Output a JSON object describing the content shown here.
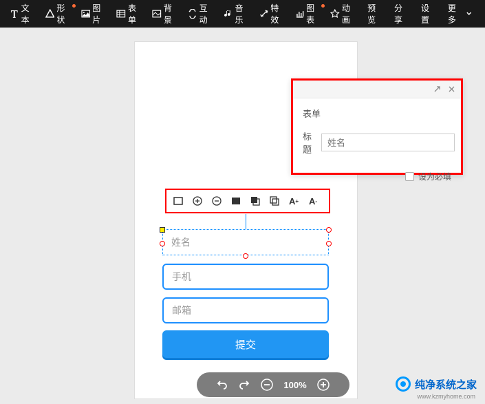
{
  "toolbar": {
    "items": [
      {
        "label": "文本"
      },
      {
        "label": "形状"
      },
      {
        "label": "图片"
      },
      {
        "label": "表单"
      },
      {
        "label": "背景"
      },
      {
        "label": "互动"
      },
      {
        "label": "音乐"
      },
      {
        "label": "特效"
      },
      {
        "label": "图表"
      },
      {
        "label": "动画"
      }
    ],
    "right": [
      {
        "label": "预览"
      },
      {
        "label": "分享"
      },
      {
        "label": "设置"
      },
      {
        "label": "更多"
      }
    ]
  },
  "form": {
    "fields": [
      {
        "placeholder": "姓名"
      },
      {
        "placeholder": "手机"
      },
      {
        "placeholder": "邮箱"
      }
    ],
    "submit": "提交"
  },
  "zoom": {
    "value": "100%"
  },
  "panel": {
    "title": "表单",
    "field_label": "标题",
    "field_placeholder": "姓名",
    "required_label": "设为必填"
  },
  "watermark": {
    "text": "纯净系统之家",
    "url": "www.kzmyhome.com"
  }
}
